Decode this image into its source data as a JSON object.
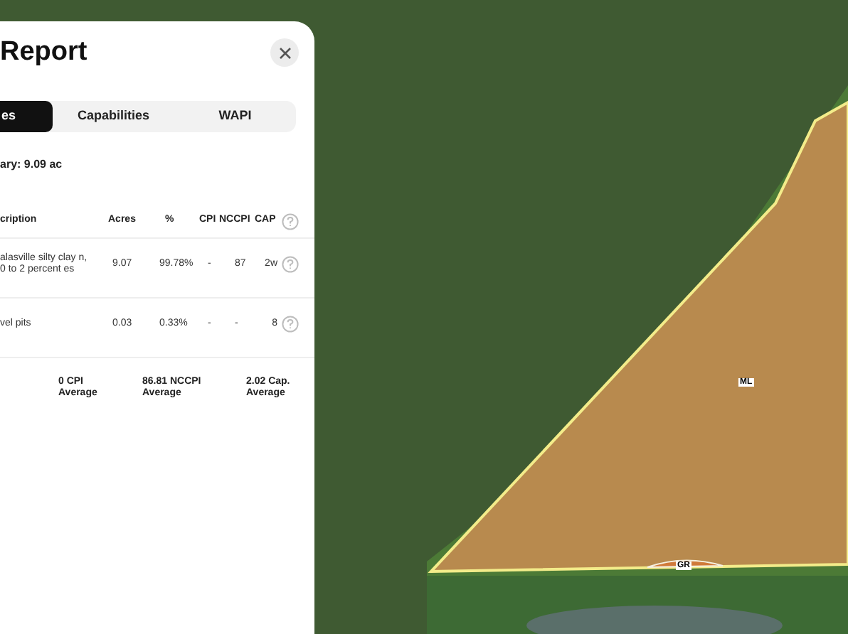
{
  "panel": {
    "title": "Report",
    "tabs": [
      {
        "label": "es",
        "selected": true
      },
      {
        "label": "Capabilities",
        "selected": false
      },
      {
        "label": "WAPI",
        "selected": false
      }
    ],
    "summary": "ary: 9.09 ac",
    "table": {
      "columns": [
        "cription",
        "Acres",
        "%",
        "CPI",
        "NCCPI",
        "CAP"
      ],
      "rows": [
        {
          "description": "alasville silty clay n, 0 to 2 percent es",
          "acres": "9.07",
          "percent": "99.78%",
          "cpi": "-",
          "nccpi": "87",
          "cap": "2w"
        },
        {
          "description": "vel pits",
          "acres": "0.03",
          "percent": "0.33%",
          "cpi": "-",
          "nccpi": "-",
          "cap": "8"
        }
      ],
      "averages": [
        "0 CPI Average",
        "86.81 NCCPI Average",
        "2.02 Cap. Average"
      ]
    }
  },
  "map": {
    "labels": [
      "ML",
      "GR"
    ]
  }
}
